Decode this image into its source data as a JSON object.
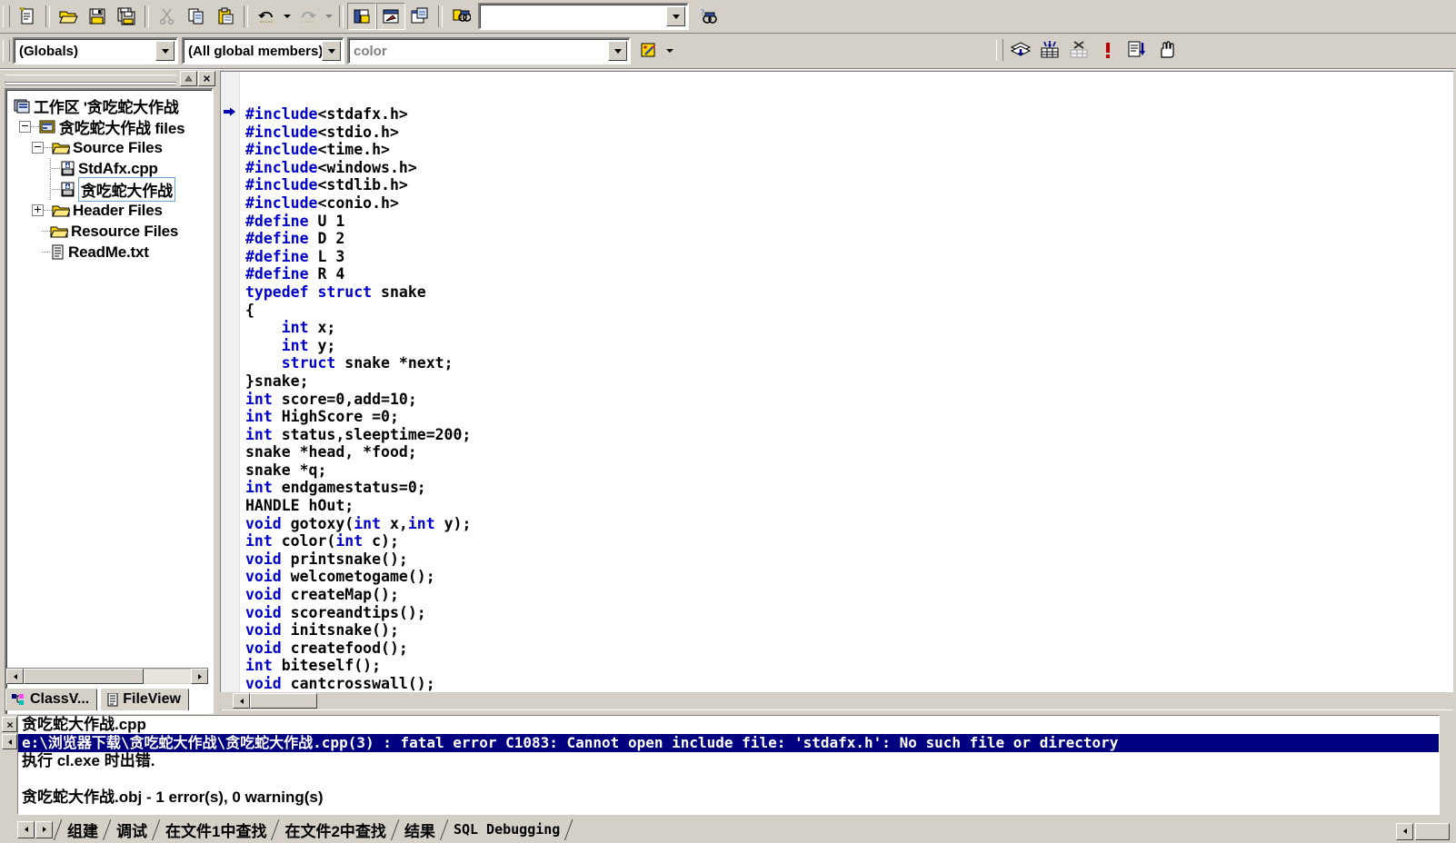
{
  "toolbar_main": {
    "buttons": [
      {
        "name": "new-text-file-button",
        "icon": "new-file-icon"
      },
      {
        "name": "open-button",
        "icon": "open-folder-icon"
      },
      {
        "name": "save-button",
        "icon": "floppy-save-icon"
      },
      {
        "name": "save-all-button",
        "icon": "floppy-save-all-icon"
      },
      {
        "name": "cut-button",
        "icon": "scissors-icon"
      },
      {
        "name": "copy-button",
        "icon": "copy-pages-icon"
      },
      {
        "name": "paste-button",
        "icon": "clipboard-paste-icon"
      },
      {
        "name": "undo-button",
        "icon": "undo-arrow-icon"
      },
      {
        "name": "redo-button",
        "icon": "redo-arrow-icon"
      },
      {
        "name": "workspace-toggle-button",
        "icon": "workspace-window-icon"
      },
      {
        "name": "output-toggle-button",
        "icon": "output-window-icon"
      },
      {
        "name": "watch-window-button",
        "icon": "watch-window-icon"
      },
      {
        "name": "find-in-files-button",
        "icon": "binoculars-files-icon"
      }
    ],
    "find_combo_value": "",
    "find_in_files_icon": "binoculars-question-icon"
  },
  "toolbar_wizard": {
    "class_combo": {
      "value": "(Globals)"
    },
    "filter_combo": {
      "value": "(All global members)"
    },
    "member_combo": {
      "value": "color"
    },
    "wizardbar_action_icon": "wizardbar-icon"
  },
  "toolbar_build": {
    "buttons": [
      {
        "name": "compile-button",
        "icon": "compile-stack-icon"
      },
      {
        "name": "build-button",
        "icon": "build-bricks-icon"
      },
      {
        "name": "stop-build-button",
        "icon": "stop-build-icon"
      },
      {
        "name": "execute-program-button",
        "icon": "exclamation-run-icon"
      },
      {
        "name": "go-button",
        "icon": "step-into-doc-icon"
      },
      {
        "name": "insert-breakpoint-button",
        "icon": "hand-breakpoint-icon"
      }
    ]
  },
  "workspace": {
    "title_buttons": [
      {
        "name": "workspace-minimize-button",
        "icon": "up-triangle-icon"
      },
      {
        "name": "workspace-close-button",
        "icon": "close-x-icon"
      }
    ],
    "tree": [
      {
        "label": "工作区 '贪吃蛇大作战",
        "icon": "workspace-icon",
        "depth": 0,
        "expander": "none",
        "selected": false
      },
      {
        "label": "贪吃蛇大作战 files",
        "icon": "project-icon",
        "depth": 1,
        "expander": "minus",
        "selected": false
      },
      {
        "label": "Source Files",
        "icon": "folder-icon",
        "depth": 2,
        "expander": "minus",
        "selected": false
      },
      {
        "label": "StdAfx.cpp",
        "icon": "cpp-file-icon",
        "depth": 3,
        "expander": "none",
        "selected": false
      },
      {
        "label": "贪吃蛇大作战",
        "icon": "cpp-file-icon",
        "depth": 3,
        "expander": "none",
        "selected": true
      },
      {
        "label": "Header Files",
        "icon": "folder-icon",
        "depth": 2,
        "expander": "plus",
        "selected": false
      },
      {
        "label": "Resource Files",
        "icon": "folder-icon",
        "depth": 2,
        "expander": "none",
        "selected": false
      },
      {
        "label": "ReadMe.txt",
        "icon": "text-file-icon",
        "depth": 2,
        "expander": "none",
        "selected": false
      }
    ],
    "hscroll": {
      "left_icon": "left-arrow-icon",
      "right_icon": "right-arrow-icon"
    },
    "tabs": [
      {
        "label": "ClassV...",
        "icon": "classview-icon",
        "active": false
      },
      {
        "label": "FileView",
        "icon": "fileview-icon",
        "active": true
      }
    ]
  },
  "editor": {
    "current_line_marker": "blue-arrow-marker",
    "lines": [
      [
        {
          "t": "#include",
          "c": "pp"
        },
        {
          "t": "<stdafx.h>",
          "c": ""
        }
      ],
      [
        {
          "t": "#include",
          "c": "pp"
        },
        {
          "t": "<stdio.h>",
          "c": ""
        }
      ],
      [
        {
          "t": "#include",
          "c": "pp"
        },
        {
          "t": "<time.h>",
          "c": ""
        }
      ],
      [
        {
          "t": "#include",
          "c": "pp"
        },
        {
          "t": "<windows.h>",
          "c": ""
        }
      ],
      [
        {
          "t": "#include",
          "c": "pp"
        },
        {
          "t": "<stdlib.h>",
          "c": ""
        }
      ],
      [
        {
          "t": "#include",
          "c": "pp"
        },
        {
          "t": "<conio.h>",
          "c": ""
        }
      ],
      [
        {
          "t": "#define",
          "c": "pp"
        },
        {
          "t": " U 1",
          "c": ""
        }
      ],
      [
        {
          "t": "#define",
          "c": "pp"
        },
        {
          "t": " D 2",
          "c": ""
        }
      ],
      [
        {
          "t": "#define",
          "c": "pp"
        },
        {
          "t": " L 3",
          "c": ""
        }
      ],
      [
        {
          "t": "#define",
          "c": "pp"
        },
        {
          "t": " R 4",
          "c": ""
        }
      ],
      [
        {
          "t": "typedef struct",
          "c": "kw"
        },
        {
          "t": " snake",
          "c": ""
        }
      ],
      [
        {
          "t": "{",
          "c": ""
        }
      ],
      [
        {
          "t": "    ",
          "c": ""
        },
        {
          "t": "int",
          "c": "kw"
        },
        {
          "t": " x;",
          "c": ""
        }
      ],
      [
        {
          "t": "    ",
          "c": ""
        },
        {
          "t": "int",
          "c": "kw"
        },
        {
          "t": " y;",
          "c": ""
        }
      ],
      [
        {
          "t": "    ",
          "c": ""
        },
        {
          "t": "struct",
          "c": "kw"
        },
        {
          "t": " snake *next;",
          "c": ""
        }
      ],
      [
        {
          "t": "}snake;",
          "c": ""
        }
      ],
      [
        {
          "t": "int",
          "c": "kw"
        },
        {
          "t": " score=0,add=10;",
          "c": ""
        }
      ],
      [
        {
          "t": "int",
          "c": "kw"
        },
        {
          "t": " HighScore =0;",
          "c": ""
        }
      ],
      [
        {
          "t": "int",
          "c": "kw"
        },
        {
          "t": " status,sleeptime=200;",
          "c": ""
        }
      ],
      [
        {
          "t": "snake *head, *food;",
          "c": ""
        }
      ],
      [
        {
          "t": "snake *q;",
          "c": ""
        }
      ],
      [
        {
          "t": "int",
          "c": "kw"
        },
        {
          "t": " endgamestatus=0;",
          "c": ""
        }
      ],
      [
        {
          "t": "HANDLE hOut;",
          "c": ""
        }
      ],
      [
        {
          "t": "void",
          "c": "kw"
        },
        {
          "t": " gotoxy(",
          "c": ""
        },
        {
          "t": "int",
          "c": "kw"
        },
        {
          "t": " x,",
          "c": ""
        },
        {
          "t": "int",
          "c": "kw"
        },
        {
          "t": " y);",
          "c": ""
        }
      ],
      [
        {
          "t": "int",
          "c": "kw"
        },
        {
          "t": " color(",
          "c": ""
        },
        {
          "t": "int",
          "c": "kw"
        },
        {
          "t": " c);",
          "c": ""
        }
      ],
      [
        {
          "t": "void",
          "c": "kw"
        },
        {
          "t": " printsnake();",
          "c": ""
        }
      ],
      [
        {
          "t": "void",
          "c": "kw"
        },
        {
          "t": " welcometogame();",
          "c": ""
        }
      ],
      [
        {
          "t": "void",
          "c": "kw"
        },
        {
          "t": " createMap();",
          "c": ""
        }
      ],
      [
        {
          "t": "void",
          "c": "kw"
        },
        {
          "t": " scoreandtips();",
          "c": ""
        }
      ],
      [
        {
          "t": "void",
          "c": "kw"
        },
        {
          "t": " initsnake();",
          "c": ""
        }
      ],
      [
        {
          "t": "void",
          "c": "kw"
        },
        {
          "t": " createfood();",
          "c": ""
        }
      ],
      [
        {
          "t": "int",
          "c": "kw"
        },
        {
          "t": " biteself();",
          "c": ""
        }
      ],
      [
        {
          "t": "void",
          "c": "kw"
        },
        {
          "t": " cantcrosswall();",
          "c": ""
        }
      ]
    ],
    "hscroll": {
      "left_icon": "left-arrow-icon"
    }
  },
  "output": {
    "side_buttons": [
      {
        "name": "output-close-button",
        "icon": "close-x-icon"
      },
      {
        "name": "output-scroll-up-button",
        "icon": "up-arrow-icon"
      }
    ],
    "lines": [
      {
        "text": "贪吃蛇大作战.cpp",
        "highlight": false,
        "cjk": true
      },
      {
        "text": "e:\\浏览器下载\\贪吃蛇大作战\\贪吃蛇大作战.cpp(3) : fatal error C1083: Cannot open include file: 'stdafx.h': No such file or directory",
        "highlight": true,
        "cjk": false
      },
      {
        "text": "执行 cl.exe 时出错.",
        "highlight": false,
        "cjk": true
      },
      {
        "text": "",
        "highlight": false,
        "cjk": false
      },
      {
        "text": "贪吃蛇大作战.obj - 1 error(s), 0 warning(s)",
        "highlight": false,
        "cjk": true
      }
    ],
    "tab_nav": [
      {
        "name": "output-tab-prev-button",
        "icon": "left-arrow-icon"
      },
      {
        "name": "output-tab-next-button",
        "icon": "right-arrow-icon"
      }
    ],
    "tabs": [
      {
        "label": "组建",
        "active": true
      },
      {
        "label": "调试",
        "active": false
      },
      {
        "label": "在文件1中查找",
        "active": false
      },
      {
        "label": "在文件2中查找",
        "active": false
      },
      {
        "label": "结果",
        "active": false
      },
      {
        "label": "SQL Debugging",
        "active": false
      }
    ],
    "right_nav": [
      {
        "name": "output-hscroll-left-button",
        "icon": "left-arrow-icon"
      }
    ]
  },
  "colors": {
    "chrome": "#d4d0c8",
    "keyword": "#0000cc",
    "selection": "#000080",
    "selection_text": "#ffffff",
    "editor_bg": "#ffffff",
    "gutter": "#f0f0f0"
  }
}
